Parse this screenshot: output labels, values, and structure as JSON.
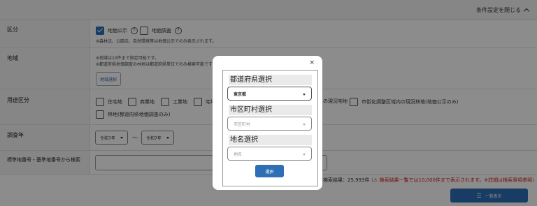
{
  "toggle": {
    "label": "条件設定を閉じる"
  },
  "kubun": {
    "label": "区分",
    "options": [
      {
        "label": "地価公示",
        "checked": true
      },
      {
        "label": "地価調査",
        "checked": false
      }
    ],
    "note": "※森林法、公園法、自然環境等は地価公示でのみ表示されます。"
  },
  "chiiki": {
    "label": "地域",
    "notes": [
      "※地域は10件まで指定可能です。",
      "※都道府県地価調査の林地は都道府県単位でのみ検索可能です"
    ],
    "button": "地域選択"
  },
  "yoto": {
    "label": "用途区分",
    "options": [
      "住宅地",
      "商業地",
      "工業地",
      "宅地",
      "の現況宅地",
      "市街化調整区域内の現況林地(地価公示のみ)",
      "林地(都道府県地価調査のみ)"
    ]
  },
  "nen": {
    "label": "調査年",
    "from": "令和7年",
    "sep": "〜",
    "to": "令和7年"
  },
  "bango": {
    "label": "標準地番号・基準地番号から検索"
  },
  "results": {
    "count": "検索結果：25,993件",
    "warning": "（⚠ 検索結果一覧では10,000件まで表示されます。※詳細は検索事項参照）"
  },
  "list_button": "一覧表示",
  "modal": {
    "close": "×",
    "pref_heading": "都道府県選択",
    "pref_value": "東京都",
    "city_heading": "市区町村選択",
    "city_placeholder": "市区町村",
    "place_heading": "地名選択",
    "place_placeholder": "地名",
    "select_button": "選択"
  }
}
